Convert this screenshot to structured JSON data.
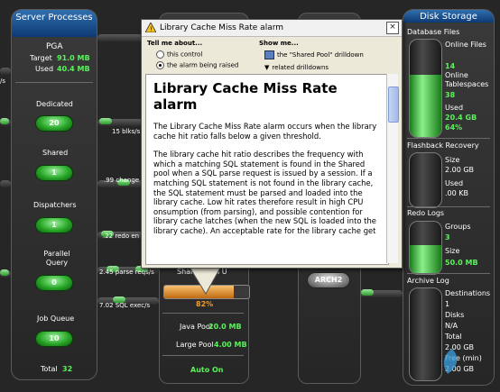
{
  "server_processes": {
    "title": "Server Processes",
    "pga_label": "PGA",
    "target_label": "Target",
    "target_value": "91.0 MB",
    "used_label": "Used",
    "used_value": "40.4 MB",
    "dedicated_label": "Dedicated",
    "dedicated_value": "20",
    "shared_label": "Shared",
    "shared_value": "1",
    "dispatchers_label": "Dispatchers",
    "dispatchers_value": "1",
    "parallel_query_label": "Parallel Query",
    "parallel_query_value": "0",
    "job_queue_label": "Job Queue",
    "job_queue_value": "10",
    "total_label": "Total",
    "total_value": "32"
  },
  "flows": {
    "blks": "15 blks/s",
    "changes": ".99 change",
    "redo": ".22 redo en",
    "parse": "2.45 parse reqs/s",
    "sql": "7.02 SQL exec/s",
    "left_edge": "/s"
  },
  "sga": {
    "shared_pool_label": "Shared Pool U",
    "shared_pool_pct": "82%",
    "shared_pool_fill": 0.82,
    "java_pool_label": "Java Pool",
    "java_pool_value": "20.0 MB",
    "large_pool_label": "Large Pool",
    "large_pool_value": "4.00 MB",
    "auto_on": "Auto On",
    "arch_label": "ARCH2"
  },
  "disk_storage": {
    "title": "Disk Storage",
    "db_files": {
      "label": "Database Files",
      "online_files_label": "Online Files",
      "online_files_value": "14",
      "online_ts_label": "Online Tablespaces",
      "online_ts_value": "38",
      "used_label": "Used",
      "used_value": "20.4 GB",
      "pct": "64%",
      "fill": 0.64
    },
    "flashback": {
      "label": "Flashback Recovery",
      "size_label": "Size",
      "size_value": "2.00 GB",
      "used_label": "Used",
      "used_value": ".00 KB",
      "fill": 0.0
    },
    "redo": {
      "label": "Redo Logs",
      "groups_label": "Groups",
      "groups_value": "3",
      "size_label": "Size",
      "size_value": "50.0 MB",
      "fill": 0.55
    },
    "archive": {
      "label": "Archive Log",
      "dest_label": "Destinations",
      "dest_value": "1",
      "disks_label": "Disks",
      "disks_value": "N/A",
      "total_label": "Total",
      "total_value": "2.00 GB",
      "free_label": "Free (min)",
      "free_value": "2.00 GB",
      "fill": 0.0
    }
  },
  "popup": {
    "title": "Library Cache Miss Rate alarm",
    "tell_me_label": "Tell me about...",
    "option_control": "this control",
    "option_alarm": "the alarm being raised",
    "show_me_label": "Show me...",
    "show_link": "the \"Shared Pool\" drilldown",
    "related_link": "related drilldowns",
    "heading": "Library Cache Miss Rate alarm",
    "para1": "The Library Cache Miss Rate alarm occurs when the library cache hit ratio falls below a given threshold.",
    "para2": "The library cache hit ratio describes the frequency with which a matching SQL statement is found in the Shared pool when a SQL parse request is issued by a session. If a matching SQL statement is not found in the library cache, the SQL statement must be parsed and loaded into the library cache. Low hit rates therefore result in high CPU onsumption (from parsing), and possible contention for library cache latches (when the new SQL is loaded into the library cache). An acceptable rate for the library cache get"
  },
  "watermark": "亿速云"
}
